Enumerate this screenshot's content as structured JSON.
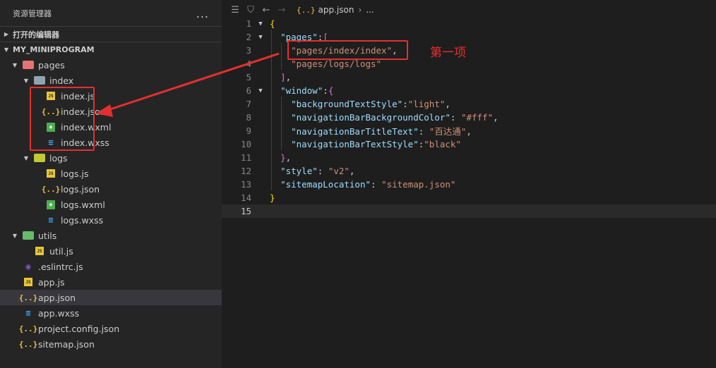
{
  "sidebar": {
    "title": "资源管理器",
    "more": "...",
    "open_editors": "打开的编辑器",
    "project": "MY_MINIPROGRAM",
    "tree": [
      {
        "label": "pages",
        "type": "folder-pages",
        "depth": 0,
        "expanded": true
      },
      {
        "label": "index",
        "type": "folder-gray",
        "depth": 1,
        "expanded": true
      },
      {
        "label": "index.js",
        "type": "js",
        "depth": 2
      },
      {
        "label": "index.json",
        "type": "json",
        "depth": 2
      },
      {
        "label": "index.wxml",
        "type": "wxml",
        "depth": 2
      },
      {
        "label": "index.wxss",
        "type": "wxss",
        "depth": 2
      },
      {
        "label": "logs",
        "type": "folder-yellow",
        "depth": 1,
        "expanded": true
      },
      {
        "label": "logs.js",
        "type": "js",
        "depth": 2
      },
      {
        "label": "logs.json",
        "type": "json",
        "depth": 2
      },
      {
        "label": "logs.wxml",
        "type": "wxml",
        "depth": 2
      },
      {
        "label": "logs.wxss",
        "type": "wxss",
        "depth": 2
      },
      {
        "label": "utils",
        "type": "folder-green",
        "depth": 0,
        "expanded": true
      },
      {
        "label": "util.js",
        "type": "js",
        "depth": 1
      },
      {
        "label": ".eslintrc.js",
        "type": "eslint",
        "depth": 0
      },
      {
        "label": "app.js",
        "type": "js",
        "depth": 0
      },
      {
        "label": "app.json",
        "type": "json",
        "depth": 0,
        "selected": true
      },
      {
        "label": "app.wxss",
        "type": "wxss",
        "depth": 0
      },
      {
        "label": "project.config.json",
        "type": "json",
        "depth": 0
      },
      {
        "label": "sitemap.json",
        "type": "json",
        "depth": 0
      }
    ]
  },
  "editor": {
    "breadcrumb_file": "app.json",
    "breadcrumb_more": "...",
    "current_line": 15,
    "lines": [
      {
        "n": "1",
        "fold": true,
        "tokens": [
          [
            "br",
            "{"
          ]
        ]
      },
      {
        "n": "2",
        "fold": true,
        "tokens": [
          [
            "p",
            "  "
          ],
          [
            "k",
            "\"pages\""
          ],
          [
            "p",
            ":"
          ],
          [
            "br2",
            "["
          ]
        ]
      },
      {
        "n": "3",
        "fold": false,
        "tokens": [
          [
            "p",
            "    "
          ],
          [
            "s",
            "\"pages/index/index\""
          ],
          [
            "p",
            ","
          ]
        ]
      },
      {
        "n": "4",
        "fold": false,
        "tokens": [
          [
            "p",
            "    "
          ],
          [
            "s",
            "\"pages/logs/logs\""
          ]
        ]
      },
      {
        "n": "5",
        "fold": false,
        "tokens": [
          [
            "p",
            "  "
          ],
          [
            "br2",
            "]"
          ],
          [
            "p",
            ","
          ]
        ]
      },
      {
        "n": "6",
        "fold": true,
        "tokens": [
          [
            "p",
            "  "
          ],
          [
            "k",
            "\"window\""
          ],
          [
            "p",
            ":"
          ],
          [
            "br2",
            "{"
          ]
        ]
      },
      {
        "n": "7",
        "fold": false,
        "tokens": [
          [
            "p",
            "    "
          ],
          [
            "k",
            "\"backgroundTextStyle\""
          ],
          [
            "p",
            ":"
          ],
          [
            "s",
            "\"light\""
          ],
          [
            "p",
            ","
          ]
        ]
      },
      {
        "n": "8",
        "fold": false,
        "tokens": [
          [
            "p",
            "    "
          ],
          [
            "k",
            "\"navigationBarBackgroundColor\""
          ],
          [
            "p",
            ": "
          ],
          [
            "s",
            "\"#fff\""
          ],
          [
            "p",
            ","
          ]
        ]
      },
      {
        "n": "9",
        "fold": false,
        "tokens": [
          [
            "p",
            "    "
          ],
          [
            "k",
            "\"navigationBarTitleText\""
          ],
          [
            "p",
            ": "
          ],
          [
            "s",
            "\"百达通\""
          ],
          [
            "p",
            ","
          ]
        ]
      },
      {
        "n": "10",
        "fold": false,
        "tokens": [
          [
            "p",
            "    "
          ],
          [
            "k",
            "\"navigationBarTextStyle\""
          ],
          [
            "p",
            ":"
          ],
          [
            "s",
            "\"black\""
          ]
        ]
      },
      {
        "n": "11",
        "fold": false,
        "tokens": [
          [
            "p",
            "  "
          ],
          [
            "br2",
            "}"
          ],
          [
            "p",
            ","
          ]
        ]
      },
      {
        "n": "12",
        "fold": false,
        "tokens": [
          [
            "p",
            "  "
          ],
          [
            "k",
            "\"style\""
          ],
          [
            "p",
            ": "
          ],
          [
            "s",
            "\"v2\""
          ],
          [
            "p",
            ","
          ]
        ]
      },
      {
        "n": "13",
        "fold": false,
        "tokens": [
          [
            "p",
            "  "
          ],
          [
            "k",
            "\"sitemapLocation\""
          ],
          [
            "p",
            ": "
          ],
          [
            "s",
            "\"sitemap.json\""
          ]
        ]
      },
      {
        "n": "14",
        "fold": false,
        "tokens": [
          [
            "br",
            "}"
          ]
        ]
      },
      {
        "n": "15",
        "fold": false,
        "tokens": []
      }
    ]
  },
  "annotation": {
    "label": "第一项",
    "color": "#e3302f"
  },
  "colors": {
    "sidebar_bg": "#252526",
    "editor_bg": "#1e1e1e",
    "key": "#9cdcfe",
    "string": "#ce9178",
    "selected": "#37373d"
  }
}
